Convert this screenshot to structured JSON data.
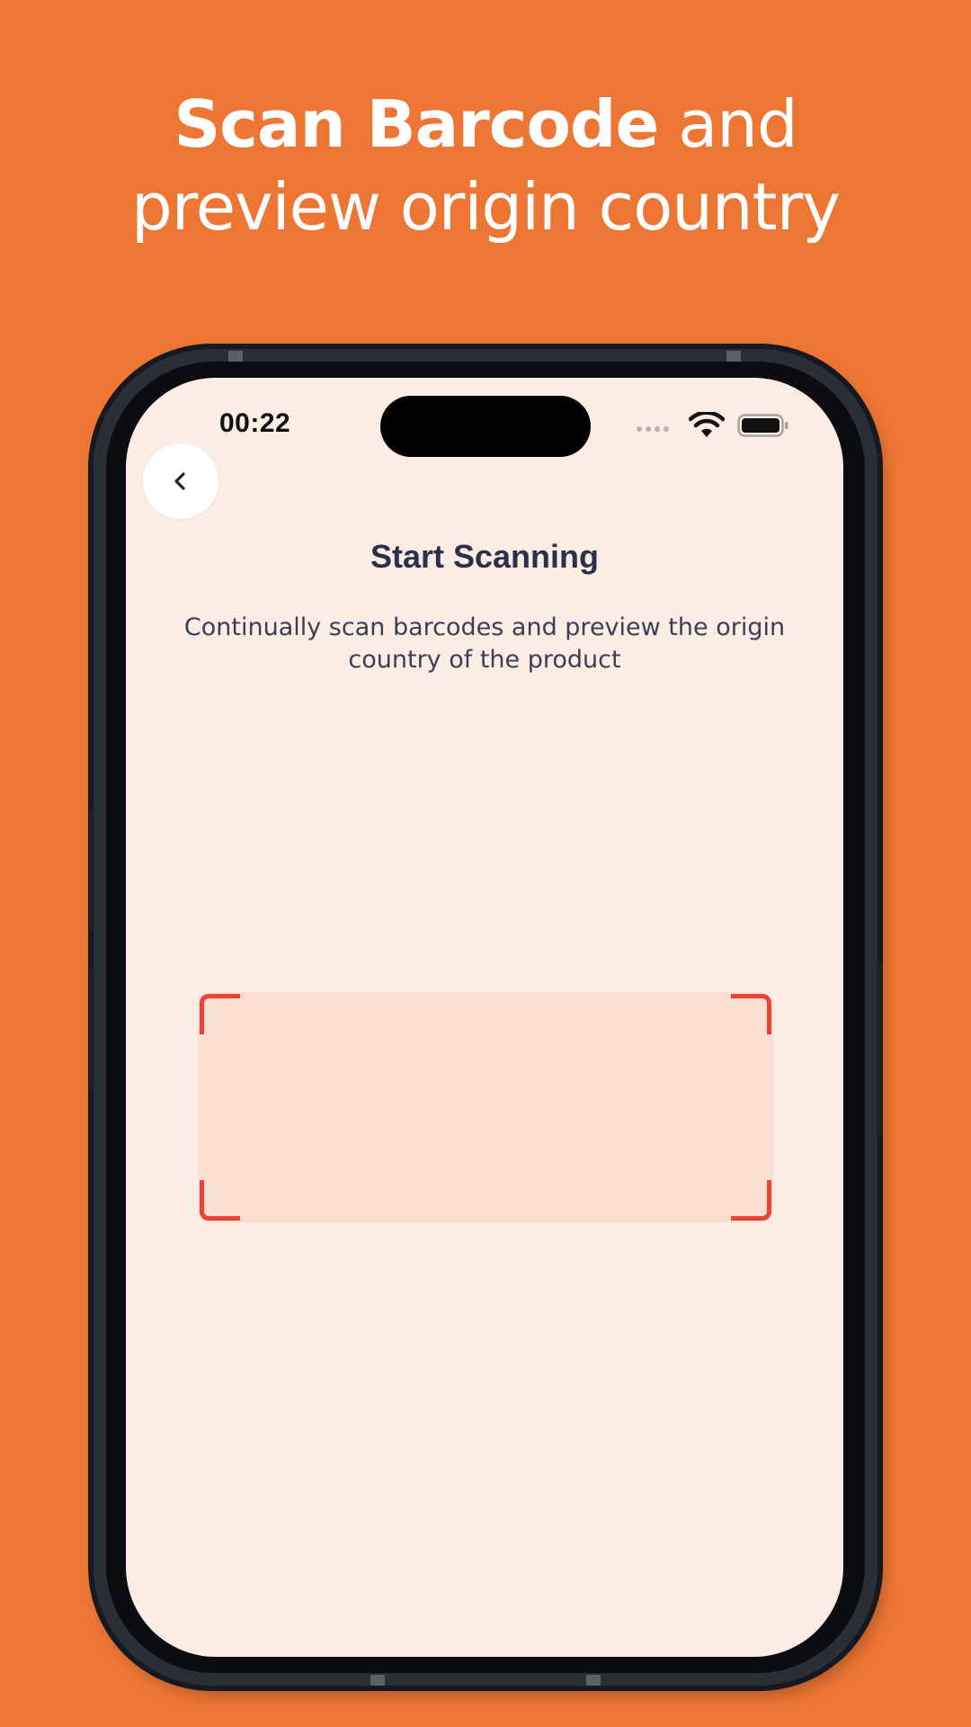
{
  "headline": {
    "bold": "Scan Barcode",
    "rest": " and",
    "line2": "preview origin country"
  },
  "status_bar": {
    "time": "00:22",
    "icons": [
      "signal-dots-icon",
      "wifi-icon",
      "battery-icon"
    ]
  },
  "screen": {
    "back_icon": "chevron-left-icon",
    "title": "Start Scanning",
    "subtitle": "Continually scan barcodes and preview the origin country of the product"
  },
  "colors": {
    "background": "#EE7634",
    "screen_bg": "#FCEDE4",
    "scan_area": "#FADFD0",
    "scan_corners": "#EC4136",
    "title": "#2B3149"
  }
}
